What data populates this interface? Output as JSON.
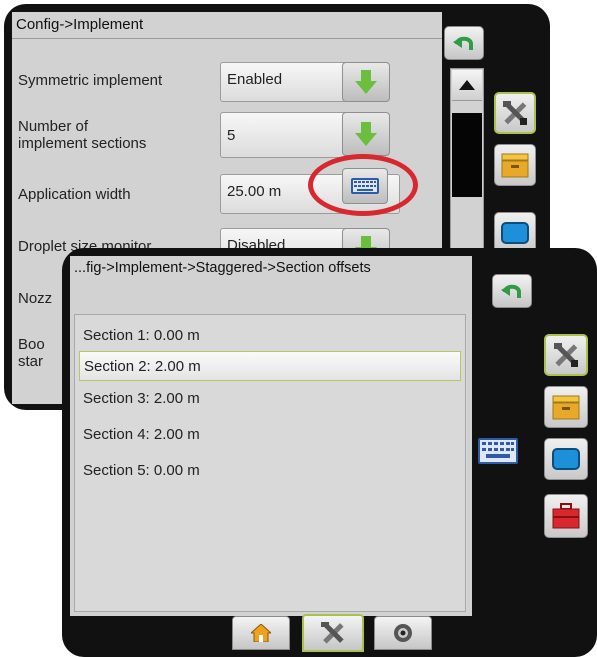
{
  "back_window": {
    "title": "Config->Implement",
    "rows": [
      {
        "label": "Symmetric implement",
        "value": "Enabled"
      },
      {
        "label": "Number of\nimplement sections",
        "value": "5"
      },
      {
        "label": "Application width",
        "value": "25.00 m"
      },
      {
        "label": "Droplet size monitor",
        "value": "Disabled"
      },
      {
        "label": "Nozz"
      },
      {
        "label": "Boo\nstar"
      }
    ]
  },
  "front_window": {
    "title": "...fig->Implement->Staggered->Section offsets",
    "sections": [
      "Section 1: 0.00 m",
      "Section 2: 2.00 m",
      "Section 3: 2.00 m",
      "Section 4: 2.00 m",
      "Section 5: 0.00 m"
    ],
    "selected_index": 1
  },
  "icons": {
    "back": "undo-arrow-icon",
    "tools": "tools-icon",
    "tray": "job-tray-icon",
    "display": "display-icon",
    "toolbox": "toolbox-icon",
    "keyboard": "keyboard-icon",
    "home": "home-icon",
    "gps": "gps-icon"
  },
  "colors": {
    "highlight_ring": "#d7282f",
    "selected_border": "#a9c34a",
    "green_arrow": "#6cbf3e"
  }
}
